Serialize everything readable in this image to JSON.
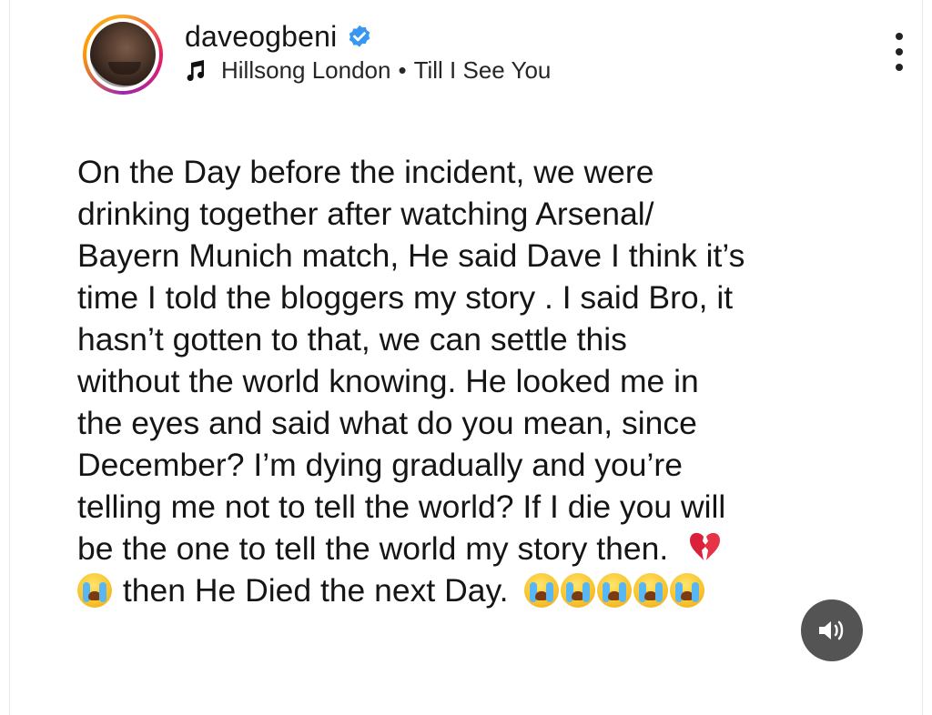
{
  "post": {
    "username": "daveogbeni",
    "verified": true,
    "music": {
      "artist": "Hillsong London",
      "separator": "•",
      "song": "Till I See You"
    }
  },
  "caption": {
    "lines": [
      "On the Day before the incident, we were",
      "drinking together after watching Arsenal/",
      "Bayern Munich match, He said Dave I think it’s",
      "time I told  the bloggers my story . I said Bro, it",
      "hasn’t gotten to that, we can settle this",
      "without the world knowing. He looked me in",
      "the eyes and said what do you mean, since",
      "December? I’m dying gradually and you’re",
      "telling me not to tell the world? If I die you will",
      "be the one to tell the world my story then.",
      "then He Died the next Day."
    ],
    "emoji": {
      "broken_heart": "broken-heart-emoji",
      "crying": "loudly-crying-face-emoji",
      "crying_count_end": 5
    }
  },
  "icons": {
    "verified": "verified-badge-icon",
    "music": "music-note-icon",
    "more": "more-options-icon",
    "sound": "speaker-on-icon"
  },
  "colors": {
    "verified": "#3897f0",
    "sound_button": "#3c3c3c"
  }
}
